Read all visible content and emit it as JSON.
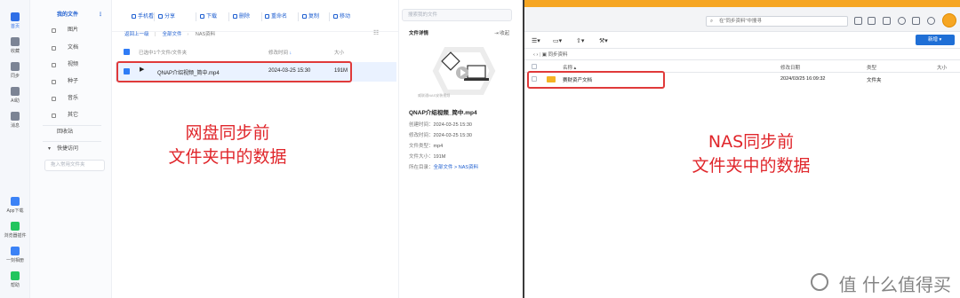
{
  "cloud": {
    "rail": [
      {
        "label": "首页",
        "icon": "cloud-icon",
        "active": true
      },
      {
        "label": "收藏",
        "icon": "star-icon"
      },
      {
        "label": "同步",
        "icon": "sync-icon"
      },
      {
        "label": "AI助",
        "icon": "ai-icon"
      },
      {
        "label": "消息",
        "icon": "message-icon"
      },
      {
        "label": "App下载",
        "icon": "app-download-icon"
      },
      {
        "label": "浏览器插件",
        "icon": "browser-plugin-icon"
      },
      {
        "label": "一刻相册",
        "icon": "album-icon"
      },
      {
        "label": "帮助",
        "icon": "help-icon"
      }
    ],
    "tree": {
      "my_files": "我的文件",
      "items": [
        "图片",
        "文档",
        "视频",
        "种子",
        "音乐",
        "其它"
      ],
      "recycle": "回收站",
      "quick_access": "快捷访问",
      "quick_placeholder": "拖入常用文件夹"
    },
    "toolbar": [
      "手机看",
      "分享",
      "下载",
      "删除",
      "重命名",
      "复制",
      "移动"
    ],
    "breadcrumb": {
      "back": "返回上一级",
      "all": "全部文件",
      "current": "NAS资料"
    },
    "table": {
      "selected_text": "已选中1个文件/文件夹",
      "col_modified": "修改时间",
      "col_size": "大小",
      "rows": [
        {
          "name": "QNAP介绍视频_简中.mp4",
          "modified": "2024-03-25 15:30",
          "size": "191M"
        }
      ]
    },
    "detail": {
      "search_placeholder": "搜索我的文件",
      "title": "文件详情",
      "collapse": "收起",
      "thumb_caption": "威联通NAS安装视频",
      "file_name": "QNAP介绍视频_简中.mp4",
      "lines": [
        {
          "k": "创建时间：",
          "v": "2024-03-25 15:30"
        },
        {
          "k": "修改时间：",
          "v": "2024-03-25 15:30"
        },
        {
          "k": "文件类型：",
          "v": "mp4"
        },
        {
          "k": "文件大小：",
          "v": "191M"
        },
        {
          "k": "所在目录：",
          "v": "全部文件 > NAS资料"
        }
      ]
    },
    "annotation": [
      "网盘同步前",
      "文件夹中的数据"
    ]
  },
  "nas": {
    "search_placeholder": "在\"同步资料\"中搜寻",
    "create_button": "新增",
    "path": "同步资料",
    "columns": {
      "name": "名称",
      "modified": "修改日期",
      "type": "类型",
      "size": "大小"
    },
    "rows": [
      {
        "name": "赛财资产文档",
        "modified": "2024/03/25 16:09:32",
        "type": "文件夹",
        "size": ""
      }
    ],
    "annotation": [
      "NAS同步前",
      "文件夹中的数据"
    ]
  },
  "watermark": "值 什么值得买",
  "colors": {
    "accent": "#2f6fe6",
    "annotation_red": "#e0262b",
    "nas_orange": "#f6a623"
  }
}
